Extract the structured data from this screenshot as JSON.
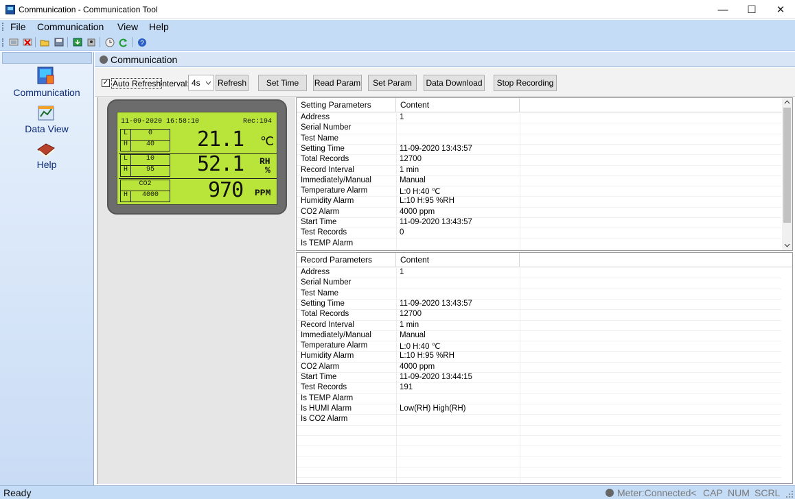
{
  "window": {
    "title": "Communication - Communication Tool"
  },
  "menu": {
    "items": [
      "File",
      "Communication",
      "View",
      "Help"
    ]
  },
  "sidebar": {
    "items": [
      {
        "label": "Communication",
        "icon": "communication-icon"
      },
      {
        "label": "Data View",
        "icon": "data-view-icon"
      },
      {
        "label": "Help",
        "icon": "help-book-icon"
      }
    ]
  },
  "panel": {
    "title": "Communication"
  },
  "controls": {
    "auto_refresh_label": "Auto Refresh",
    "auto_refresh_checked": "✓",
    "interval_label": "Interval:",
    "interval_value": "4s",
    "refresh_label": "Refresh",
    "set_time_label": "Set Time",
    "read_param_label": "Read Param",
    "set_param_label": "Set Param",
    "data_download_label": "Data Download",
    "stop_recording_label": "Stop Recording"
  },
  "lcd": {
    "datetime": "11-09-2020 16:58:10",
    "rec": "Rec:194",
    "temp_low_label": "L",
    "temp_low": "0",
    "temp_high_label": "H",
    "temp_high": "40",
    "temp_value": "21.1",
    "temp_unit": "℃",
    "rh_low_label": "L",
    "rh_low": "10",
    "rh_high_label": "H",
    "rh_high": "95",
    "rh_value": "52.1",
    "rh_unit": "RH",
    "rh_unit2": "%",
    "co2_label": "CO2",
    "co2_high_label": "H",
    "co2_high": "4000",
    "co2_value": "970",
    "co2_unit": "PPM"
  },
  "setting_table": {
    "col1": "Setting Parameters",
    "col2": "Content",
    "rows": [
      [
        "Address",
        "1"
      ],
      [
        "Serial Number",
        ""
      ],
      [
        "Test Name",
        ""
      ],
      [
        "Setting Time",
        "11-09-2020 13:43:57"
      ],
      [
        "Total Records",
        "12700"
      ],
      [
        "Record Interval",
        "1 min"
      ],
      [
        "Immediately/Manual",
        "Manual"
      ],
      [
        "Temperature Alarm",
        "L:0 H:40 ℃"
      ],
      [
        "Humidity Alarm",
        "L:10 H:95 %RH"
      ],
      [
        "CO2 Alarm",
        "4000 ppm"
      ],
      [
        "Start Time",
        "11-09-2020 13:43:57"
      ],
      [
        "Test Records",
        "0"
      ],
      [
        "Is TEMP Alarm",
        ""
      ]
    ]
  },
  "record_table": {
    "col1": "Record Parameters",
    "col2": "Content",
    "rows": [
      [
        "Address",
        "1"
      ],
      [
        "Serial Number",
        ""
      ],
      [
        "Test Name",
        ""
      ],
      [
        "Setting Time",
        "11-09-2020 13:43:57"
      ],
      [
        "Total Records",
        "12700"
      ],
      [
        "Record Interval",
        "1 min"
      ],
      [
        "Immediately/Manual",
        "Manual"
      ],
      [
        "Temperature Alarm",
        "L:0 H:40 ℃"
      ],
      [
        "Humidity Alarm",
        "L:10 H:95 %RH"
      ],
      [
        "CO2 Alarm",
        "4000 ppm"
      ],
      [
        "Start Time",
        "11-09-2020 13:44:15"
      ],
      [
        "Test Records",
        "191"
      ],
      [
        "Is TEMP Alarm",
        ""
      ],
      [
        "Is HUMI Alarm",
        "Low(RH) High(RH)"
      ],
      [
        "Is CO2 Alarm",
        ""
      ]
    ]
  },
  "status": {
    "ready": "Ready",
    "meter": "Meter:Connected<",
    "cap": "CAP",
    "num": "NUM",
    "scrl": "SCRL"
  },
  "colors": {
    "lcd": "#b9e53a",
    "chrome": "#c5dcf7"
  }
}
